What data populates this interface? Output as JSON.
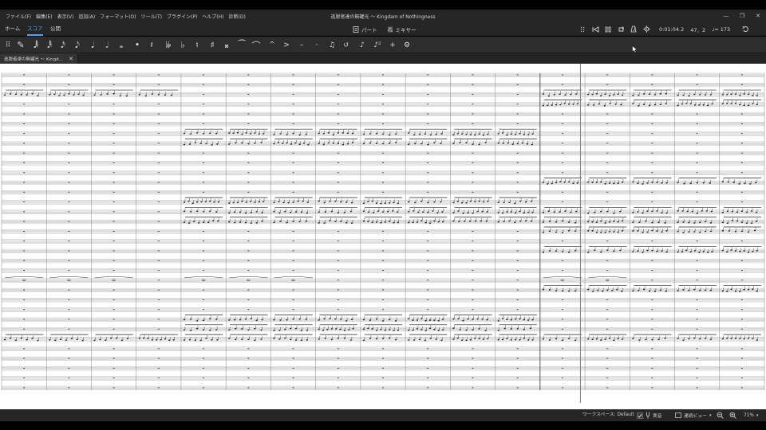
{
  "menu": [
    "ファイル(F)",
    "編集(E)",
    "表示(V)",
    "追加(A)",
    "フォーマット(O)",
    "ツール(T)",
    "プラグイン(P)",
    "ヘルプ(H)",
    "診断(D)"
  ],
  "window_title": "逃脱者達の無罐光 〜 Kingdam of Nothingness",
  "nav_tabs": [
    "ホーム",
    "スコア",
    "公開"
  ],
  "active_tab": "スコア",
  "center_tabs": {
    "parts": "パート",
    "mixer": "ミキサー"
  },
  "playback": {
    "time": "0:01:04.2",
    "position": "47．2",
    "tempo": "♩= 173"
  },
  "toolbar_icons": [
    "grip-icon",
    "pencil-icon",
    "sixty-fourth-note-icon",
    "thirty-second-note-icon",
    "sixteenth-note-icon",
    "eighth-note-icon",
    "quarter-note-icon",
    "half-note-icon",
    "whole-note-icon",
    "augmentation-dot-icon",
    "rest-icon",
    "double-flat-icon",
    "flat-icon",
    "natural-icon",
    "sharp-icon",
    "double-sharp-icon",
    "tie-icon",
    "slur-icon",
    "marcato-icon",
    "accent-icon",
    "tenuto-icon",
    "staccato-icon",
    "beam-icon",
    "flip-icon",
    "voice-icon",
    "tuplet-icon",
    "add-icon",
    "customize-icon"
  ],
  "toolbar_glyphs": [
    "⠿",
    "✎",
    "𝅘𝅥𝅲",
    "𝅘𝅥𝅱",
    "𝅘𝅥𝅯",
    "𝅘𝅥𝅮",
    "𝅘𝅥",
    "𝅗𝅥",
    "𝅝",
    "•",
    "𝄽",
    "𝄫",
    "♭",
    "♮",
    "♯",
    "𝄪",
    "⁀",
    "⌒",
    "^",
    ">",
    "–",
    "·",
    "♫",
    "↺",
    "♪",
    "♪²",
    "+",
    "⚙"
  ],
  "document_tab": {
    "label": "逃脱者達の無罐光 〜 Kingd...",
    "close": "✕"
  },
  "status": {
    "workspace": "ワークスペース: Default",
    "concert_pitch": "実音",
    "view_mode": "連続ビュー",
    "zoom": "71%"
  },
  "colors": {
    "accent": "#4aa3ff",
    "chrome": "#262626",
    "paper": "#ffffff",
    "playhead": "#3a8fd6"
  },
  "score": {
    "staff_count": 33,
    "measure_count": 17,
    "playhead_measure": 13
  }
}
